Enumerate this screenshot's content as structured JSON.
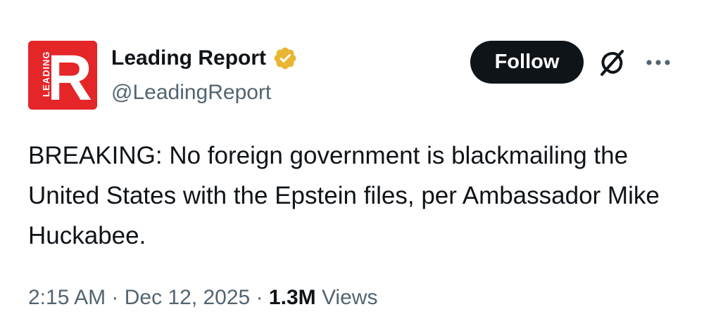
{
  "author": {
    "avatar_letter": "R",
    "avatar_side_text": "LEADING",
    "display_name": "Leading Report",
    "handle": "@LeadingReport",
    "verified_badge": "verified-gold-icon"
  },
  "actions": {
    "follow_label": "Follow",
    "grok_icon": "grok-icon",
    "more_icon": "more-icon"
  },
  "tweet": {
    "text": "BREAKING: No foreign government is blackmailing the United States with the Epstein files, per Ambassador Mike Huckabee.",
    "time": "2:15 AM",
    "separator": "·",
    "date": "Dec 12, 2025",
    "views_count": "1.3M",
    "views_label": "Views"
  },
  "colors": {
    "avatar_red": "#e42629",
    "gold_badge": "#e9b633",
    "follow_bg": "#0f1419",
    "secondary_text": "#536471"
  }
}
